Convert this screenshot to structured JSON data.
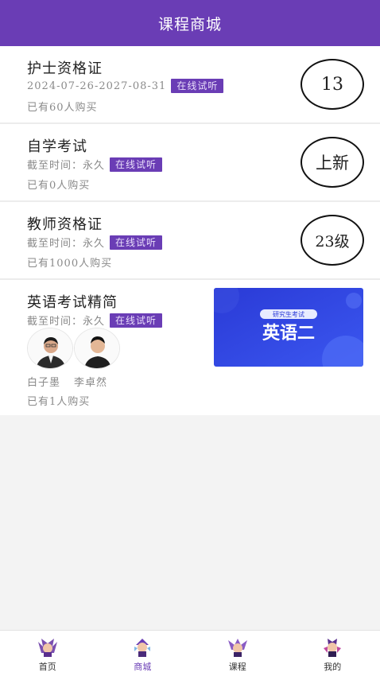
{
  "header": {
    "title": "课程商城"
  },
  "courses": [
    {
      "title": "护士资格证",
      "meta": "2024-07-26-2027-08-31",
      "tag": "在线试听",
      "buyers": "已有60人购买",
      "badge": "13"
    },
    {
      "title": "自学考试",
      "meta": "截至时间：永久",
      "tag": "在线试听",
      "buyers": "已有0人购买",
      "badge": "上新"
    },
    {
      "title": "教师资格证",
      "meta": "截至时间：永久",
      "tag": "在线试听",
      "buyers": "已有1000人购买",
      "badge": "23级"
    },
    {
      "title": "英语考试精简",
      "meta": "截至时间：永久",
      "tag": "在线试听",
      "buyers": "已有1人购买",
      "teachers": [
        "白子墨",
        "李卓然"
      ],
      "banner": {
        "subtitle": "研究生考试",
        "title": "英语二"
      }
    }
  ],
  "tabbar": [
    {
      "label": "首页",
      "icon": "home-icon",
      "active": false
    },
    {
      "label": "商城",
      "icon": "mall-icon",
      "active": true
    },
    {
      "label": "课程",
      "icon": "course-icon",
      "active": false
    },
    {
      "label": "我的",
      "icon": "profile-icon",
      "active": false
    }
  ],
  "colors": {
    "accent": "#6a3db5",
    "banner": "#2f3fd8"
  }
}
